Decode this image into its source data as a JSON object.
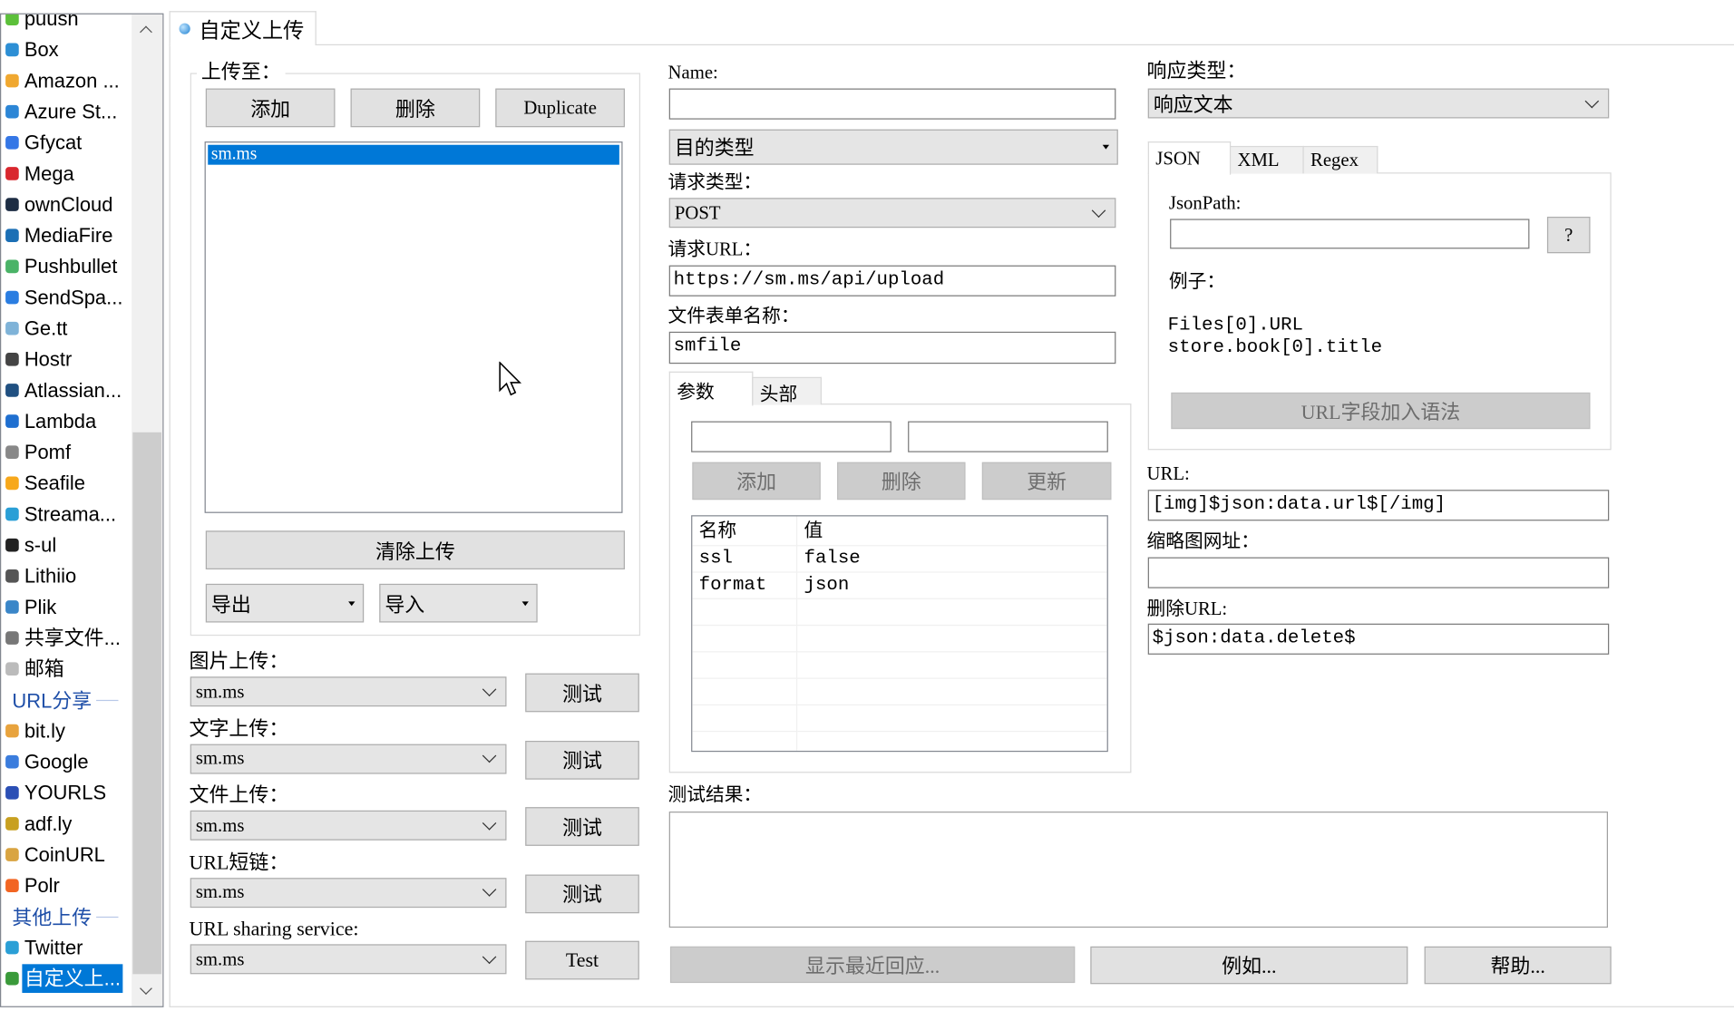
{
  "sidebar": {
    "items": [
      {
        "label": "puush",
        "color": "#5cc03a"
      },
      {
        "label": "Box",
        "color": "#2d8fd5"
      },
      {
        "label": "Amazon ...",
        "color": "#f0a830"
      },
      {
        "label": "Azure St...",
        "color": "#2c86d6"
      },
      {
        "label": "Gfycat",
        "color": "#3577e6"
      },
      {
        "label": "Mega",
        "color": "#d9272e"
      },
      {
        "label": "ownCloud",
        "color": "#1d2d44"
      },
      {
        "label": "MediaFire",
        "color": "#1b6fb5"
      },
      {
        "label": "Pushbullet",
        "color": "#4ab367"
      },
      {
        "label": "SendSpa...",
        "color": "#2a7de1"
      },
      {
        "label": "Ge.tt",
        "color": "#7fb3d8"
      },
      {
        "label": "Hostr",
        "color": "#444444"
      },
      {
        "label": "Atlassian...",
        "color": "#205081"
      },
      {
        "label": "Lambda",
        "color": "#1f6fd0"
      },
      {
        "label": "Pomf",
        "color": "#888888"
      },
      {
        "label": "Seafile",
        "color": "#f7a81b"
      },
      {
        "label": "Streama...",
        "color": "#2a9fd6"
      },
      {
        "label": "s-ul",
        "color": "#222222"
      },
      {
        "label": "Lithiio",
        "color": "#555555"
      },
      {
        "label": "Plik",
        "color": "#3a86c8"
      },
      {
        "label": "共享文件...",
        "color": "#777777"
      },
      {
        "label": "邮箱",
        "color": "#bbbbbb"
      }
    ],
    "header_url": "URL分享",
    "url_items": [
      {
        "label": "bit.ly",
        "color": "#e8a33d"
      },
      {
        "label": "Google",
        "color": "#3b7ddd"
      },
      {
        "label": "YOURLS",
        "color": "#2b4fb5"
      },
      {
        "label": "adf.ly",
        "color": "#c8a020"
      },
      {
        "label": "CoinURL",
        "color": "#d9a441"
      },
      {
        "label": "Polr",
        "color": "#f26522"
      }
    ],
    "header_other": "其他上传",
    "other_items": [
      {
        "label": "Twitter",
        "color": "#2a9fd6"
      },
      {
        "label": "自定义上...",
        "color": "#3a9a3a",
        "selected": true
      }
    ]
  },
  "tab_title": "自定义上传",
  "uploaders": {
    "group_label": "上传至：",
    "add": "添加",
    "delete": "删除",
    "duplicate": "Duplicate",
    "list": [
      "sm.ms"
    ],
    "clear": "清除上传",
    "export": "导出",
    "import": "导入"
  },
  "destinations": [
    {
      "label": "图片上传：",
      "value": "sm.ms",
      "test": "测试"
    },
    {
      "label": "文字上传：",
      "value": "sm.ms",
      "test": "测试"
    },
    {
      "label": "文件上传：",
      "value": "sm.ms",
      "test": "测试"
    },
    {
      "label": "URL短链：",
      "value": "sm.ms",
      "test": "测试"
    },
    {
      "label": "URL sharing service:",
      "value": "sm.ms",
      "test": "Test"
    }
  ],
  "request": {
    "name_label": "Name:",
    "name_value": "",
    "dest_type": "目的类型",
    "method_label": "请求类型：",
    "method": "POST",
    "url_label": "请求URL：",
    "url": "https://sm.ms/api/upload",
    "form_label": "文件表单名称：",
    "form": "smfile",
    "tabs": [
      "参数",
      "头部"
    ],
    "add": "添加",
    "delete": "删除",
    "update": "更新",
    "col_name": "名称",
    "col_value": "值",
    "params": [
      {
        "name": "ssl",
        "value": "false"
      },
      {
        "name": "format",
        "value": "json"
      }
    ]
  },
  "response": {
    "type_label": "响应类型：",
    "type": "响应文本",
    "tabs": [
      "JSON",
      "XML",
      "Regex"
    ],
    "jsonpath_label": "JsonPath:",
    "help": "?",
    "example_label": "例子：",
    "examples": [
      "Files[0].URL",
      "store.book[0].title"
    ],
    "add_syntax": "URL字段加入语法",
    "url_label": "URL:",
    "url": "[img]$json:data.url$[/img]",
    "thumb_label": "缩略图网址：",
    "thumb": "",
    "del_label": "删除URL:",
    "del": "$json:data.delete$"
  },
  "test": {
    "label": "测试结果：",
    "result": "",
    "recent": "显示最近回应...",
    "example": "例如...",
    "help": "帮助..."
  }
}
